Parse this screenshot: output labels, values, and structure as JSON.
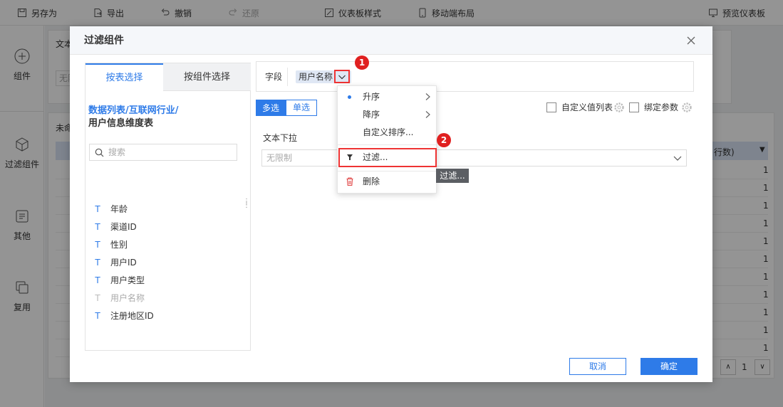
{
  "toolbar": {
    "save_as": "另存为",
    "export": "导出",
    "undo": "撤销",
    "redo": "还原",
    "dashboard_style": "仪表板样式",
    "mobile_layout": "移动端布局",
    "preview": "预览仪表板"
  },
  "rail": {
    "component": "组件",
    "filter_component": "过滤组件",
    "other": "其他",
    "reuse": "复用"
  },
  "background": {
    "text_label": "文本",
    "nolimit": "无限",
    "unnamed": "未命",
    "col_header": "行数)",
    "col_values": [
      "1",
      "1",
      "1",
      "1",
      "1",
      "1",
      "1",
      "1",
      "1",
      "1",
      "1"
    ],
    "page_number": "1"
  },
  "modal": {
    "title": "过滤组件",
    "tabs": {
      "by_table": "按表选择",
      "by_component": "按组件选择"
    },
    "datasource_path": {
      "part1": "数据列表/互联网行业/",
      "part2": "用户信息维度表"
    },
    "search_placeholder": "搜索",
    "fields": [
      "年龄",
      "渠道ID",
      "性别",
      "用户ID",
      "用户类型",
      "用户名称",
      "注册地区ID"
    ],
    "field_label": "字段",
    "selected_field": "用户名称",
    "multi_select": "多选",
    "single_select": "单选",
    "custom_value_list": "自定义值列表",
    "bind_param": "绑定参数",
    "preview_title": "文本下拉",
    "preview_placeholder": "无限制",
    "cancel": "取消",
    "confirm": "确定"
  },
  "menu": {
    "ascending": "升序",
    "descending": "降序",
    "custom_sort": "自定义排序...",
    "filter": "过滤...",
    "delete": "删除"
  },
  "tooltip": "过滤...",
  "badges": {
    "one": "1",
    "two": "2"
  },
  "colors": {
    "accent": "#2e7be8",
    "badge": "#e02020",
    "highlight_border": "#e33"
  }
}
